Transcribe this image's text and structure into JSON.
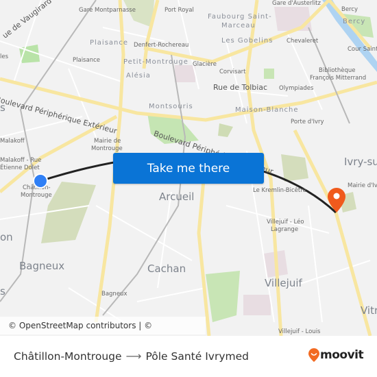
{
  "map": {
    "labels": {
      "rue_vaugirard": "ue de Vaugirard",
      "gare_montparnasse": "Gare Montparnasse",
      "port_royal": "Port Royal",
      "faubourg": "Faubourg Saint-",
      "marceau": "Marceau",
      "gare_austerlitz": "Gare d'Austerlitz",
      "bercy_station": "Bercy",
      "bercy_district": "Bercy",
      "plaisance_district": "Plaisance",
      "denfert": "Denfert-Rochereau",
      "les_gobelins": "Les Gobelins",
      "chevaleret": "Chevaleret",
      "cour_saint": "Cour Saint-",
      "left_les": "les",
      "plaisance_station": "Plaisance",
      "petit_montrouge": "Petit-Montrouge",
      "glaciere": "Glacière",
      "corvisart": "Corvisart",
      "bibliotheque": "Bibliothèque",
      "francois_mitterrand": "François Mitterrand",
      "alesia": "Alésia",
      "rue_tolbiac": "Rue de Tolbiac",
      "olympiades": "Olympiades",
      "peripherique_top": "Boulevard Périphérique Extérieur",
      "left_s": "s",
      "montsouris": "Montsouris",
      "maison_blanche": "Maison-Blanche",
      "porte_ivry": "Porte d'Ivry",
      "malakoff": "Malakoff",
      "mairie_montrouge_1": "Mairie de",
      "mairie_montrouge_2": "Montrouge",
      "peripherique_bottom": "Boulevard Périphérique Extérieur",
      "malakoff_rue_1": "Malakoff - Rue",
      "malakoff_rue_2": "Étienne Dolet",
      "ivry_sur": "Ivry-su",
      "chatillon_1": "Châtillon-",
      "chatillon_2": "Montrouge",
      "kremlin": "Le Kremlin-Bicêtre",
      "mairie_ivry": "Mairie d'Iv",
      "arcueil": "Arcueil",
      "villejuif_leo_1": "Villejuif - Léo",
      "villejuif_leo_2": "Lagrange",
      "left_on": "on",
      "bagneux_city": "Bagneux",
      "cachan": "Cachan",
      "villejuif": "Villejuif",
      "bagneux_station": "Bagneux",
      "vitry": "Vitr",
      "villejuif_louis": "Villejuif - Louis",
      "left_s2": "s"
    },
    "origin_marker_color": "#2f7ff5",
    "destination_marker_color": "#f05a1c",
    "route_color": "#222222",
    "cta_label": "Take me there",
    "attribution": "© OpenStreetMap contributors | © OpenMapTiles"
  },
  "footer": {
    "origin": "Châtillon-Montrouge",
    "arrow": "⟶",
    "destination": "Pôle Santé Ivrymed",
    "brand": "moovit",
    "brand_color": "#f26a21"
  }
}
